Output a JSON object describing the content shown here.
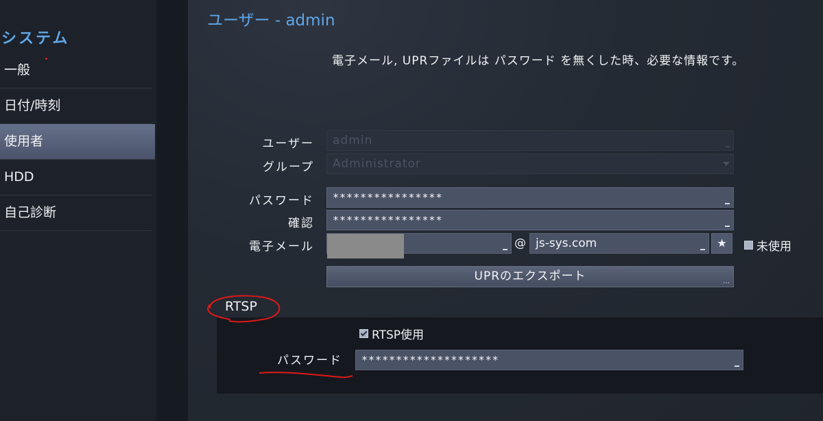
{
  "sidebar": {
    "section_title": "システム",
    "items": [
      {
        "label": "一般"
      },
      {
        "label": "日付/時刻"
      },
      {
        "label": "使用者",
        "selected": true
      },
      {
        "label": "HDD"
      },
      {
        "label": "自己診断"
      }
    ]
  },
  "main": {
    "title": "ユーザー - admin",
    "info": "電子メール, UPRファイルは パスワード を無くした時、必要な情報です。",
    "user": {
      "label": "ユーザー",
      "value": "admin"
    },
    "group": {
      "label": "グループ",
      "value": "Administrator"
    },
    "password": {
      "label": "パスワード",
      "value": "****************"
    },
    "confirm": {
      "label": "確認",
      "value": "****************"
    },
    "email": {
      "label": "電子メール",
      "user_value": "",
      "at": "@",
      "domain": "js-sys.com",
      "unused_label": "未使用",
      "unused_checked": false
    },
    "export_button": "UPRのエクスポート",
    "rtsp": {
      "heading": "RTSP",
      "use_label": "RTSP使用",
      "use_checked": true,
      "password_label": "パスワード",
      "password_value": "********************"
    }
  },
  "colors": {
    "accent": "#5fa7e8",
    "selected_item": "#4f586e",
    "annotation": "#e01818"
  },
  "icons": {
    "favorite": "star-icon",
    "dropdown": "chevron-down-icon"
  }
}
